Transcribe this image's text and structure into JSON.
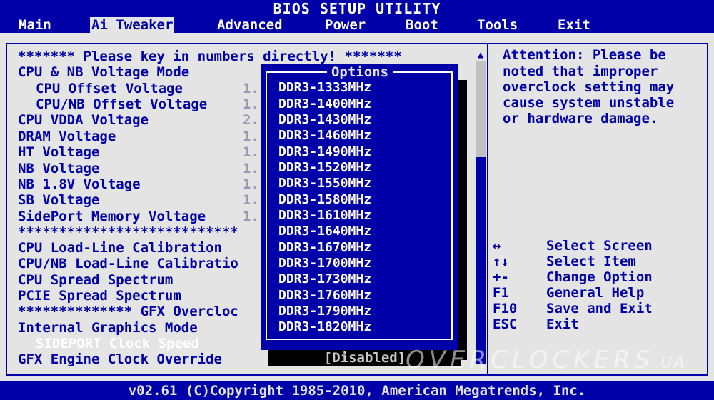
{
  "title": "BIOS SETUP UTILITY",
  "menu": [
    "Main",
    "Ai Tweaker",
    "Advanced",
    "Power",
    "Boot",
    "Tools",
    "Exit"
  ],
  "active_menu": "Ai Tweaker",
  "settings": [
    {
      "label": "******* Please key in numbers directly! *******",
      "value": ""
    },
    {
      "label": "CPU & NB Voltage Mode",
      "value": ""
    },
    {
      "label": "CPU Offset Voltage",
      "value": "1."
    },
    {
      "label": "CPU/NB Offset Voltage",
      "value": "1."
    },
    {
      "label": "CPU VDDA Voltage",
      "value": "2."
    },
    {
      "label": "DRAM Voltage",
      "value": "1."
    },
    {
      "label": "HT Voltage",
      "value": "1."
    },
    {
      "label": "NB Voltage",
      "value": "1."
    },
    {
      "label": "NB 1.8V Voltage",
      "value": "1."
    },
    {
      "label": "SB Voltage",
      "value": "1."
    },
    {
      "label": "SidePort Memory Voltage",
      "value": "1."
    },
    {
      "label": "***************************",
      "value": ""
    },
    {
      "label": "CPU Load-Line Calibration",
      "value": ""
    },
    {
      "label": "CPU/NB Load-Line Calibratio",
      "value": ""
    },
    {
      "label": "CPU Spread Spectrum",
      "value": ""
    },
    {
      "label": "PCIE Spread Spectrum",
      "value": ""
    },
    {
      "label": "************** GFX Overcloc",
      "value": ""
    },
    {
      "label": "Internal Graphics Mode",
      "value": ""
    },
    {
      "label": "SIDEPORT Clock Speed",
      "value": ""
    },
    {
      "label": "GFX Engine Clock Override",
      "value": "[Disabled]"
    }
  ],
  "popup": {
    "title": "Options",
    "options": [
      "DDR3-1333MHz",
      "DDR3-1400MHz",
      "DDR3-1430MHz",
      "DDR3-1460MHz",
      "DDR3-1490MHz",
      "DDR3-1520MHz",
      "DDR3-1550MHz",
      "DDR3-1580MHz",
      "DDR3-1610MHz",
      "DDR3-1640MHz",
      "DDR3-1670MHz",
      "DDR3-1700MHz",
      "DDR3-1730MHz",
      "DDR3-1760MHz",
      "DDR3-1790MHz",
      "DDR3-1820MHz"
    ]
  },
  "help_lines": [
    "Attention: Please be",
    "noted that improper",
    "overclock setting may",
    "cause system unstable",
    "or hardware damage."
  ],
  "keys": [
    {
      "key": "↔",
      "desc": "Select Screen"
    },
    {
      "key": "↑↓",
      "desc": "Select Item"
    },
    {
      "key": "+-",
      "desc": "Change Option"
    },
    {
      "key": "F1",
      "desc": "General Help"
    },
    {
      "key": "F10",
      "desc": "Save and Exit"
    },
    {
      "key": "ESC",
      "desc": "Exit"
    }
  ],
  "watermark": {
    "main": "OVERCLOCKERS",
    "suffix": ".UA"
  },
  "footer": "v02.61 (C)Copyright 1985-2010, American Megatrends, Inc.",
  "colors": {
    "bios_blue": "#0000a8",
    "bios_gray": "#e4e4e4"
  }
}
